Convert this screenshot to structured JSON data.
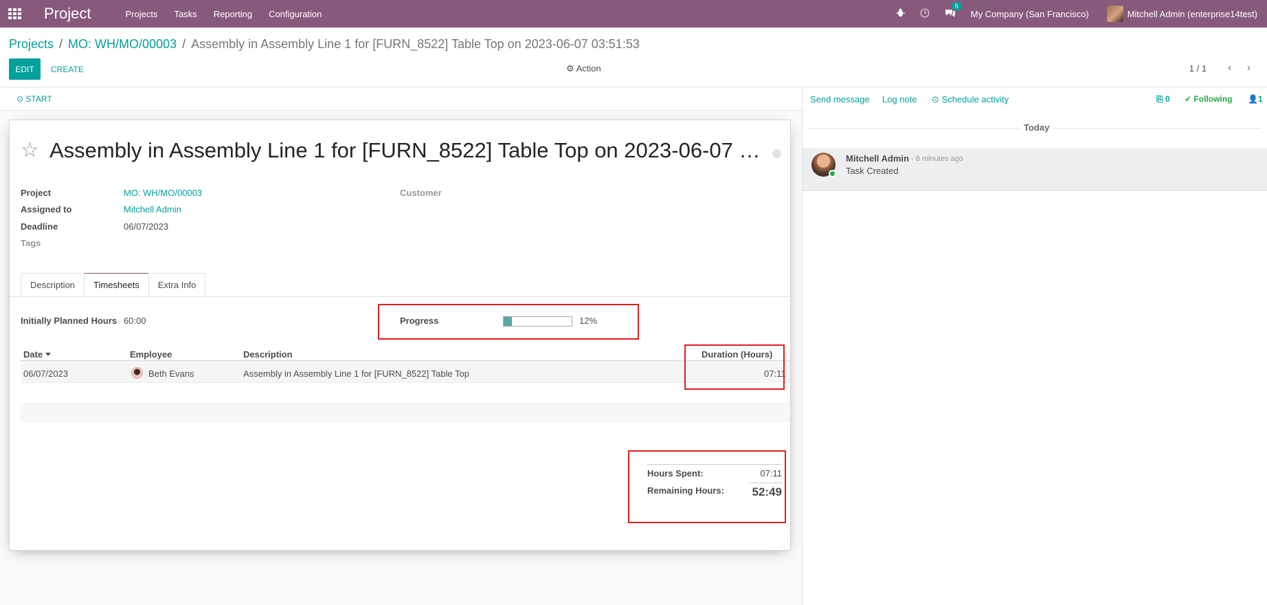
{
  "navbar": {
    "app_name": "Project",
    "menu": [
      "Projects",
      "Tasks",
      "Reporting",
      "Configuration"
    ],
    "message_count": "5",
    "company": "My Company (San Francisco)",
    "user": "Mitchell Admin (enterprise14test)"
  },
  "breadcrumb": {
    "items": [
      "Projects",
      "MO: WH/MO/00003"
    ],
    "current": "Assembly in Assembly Line 1 for [FURN_8522] Table Top on 2023-06-07 03:51:53"
  },
  "control": {
    "edit_label": "EDIT",
    "create_label": "CREATE",
    "action_label": "Action",
    "pager": "1 / 1"
  },
  "statusbar": {
    "start_label": "START"
  },
  "task": {
    "title": "Assembly in Assembly Line 1 for [FURN_8522] Table Top on 2023-06-07 03:51:53",
    "fields": {
      "project_label": "Project",
      "project_value": "MO: WH/MO/00003",
      "assigned_label": "Assigned to",
      "assigned_value": "Mitchell Admin",
      "deadline_label": "Deadline",
      "deadline_value": "06/07/2023",
      "tags_label": "Tags",
      "customer_label": "Customer"
    },
    "tabs": [
      "Description",
      "Timesheets",
      "Extra Info"
    ],
    "active_tab": "Timesheets",
    "planned_hours_label": "Initially Planned Hours",
    "planned_hours_value": "60:00",
    "progress_label": "Progress",
    "progress_text": "12%",
    "progress_value": 12,
    "timesheet": {
      "columns": [
        "Date",
        "Employee",
        "Description",
        "Duration (Hours)"
      ],
      "rows": [
        {
          "date": "06/07/2023",
          "employee": "Beth Evans",
          "description": "Assembly in Assembly Line 1 for [FURN_8522] Table Top",
          "duration": "07:11"
        }
      ]
    },
    "totals": {
      "spent_label": "Hours Spent:",
      "spent_value": "07:11",
      "remaining_label": "Remaining Hours:",
      "remaining_value": "52:49"
    }
  },
  "chatter": {
    "send_message": "Send message",
    "log_note": "Log note",
    "schedule_activity": "Schedule activity",
    "attachments_count": "0",
    "following_label": "Following",
    "followers_count": "1",
    "today_label": "Today",
    "message": {
      "author": "Mitchell Admin",
      "date": "- 8 minutes ago",
      "body": "Task Created"
    }
  },
  "colors": {
    "brand": "#875a7b",
    "accent": "#00a09d",
    "highlight_box": "#e01d1d"
  }
}
